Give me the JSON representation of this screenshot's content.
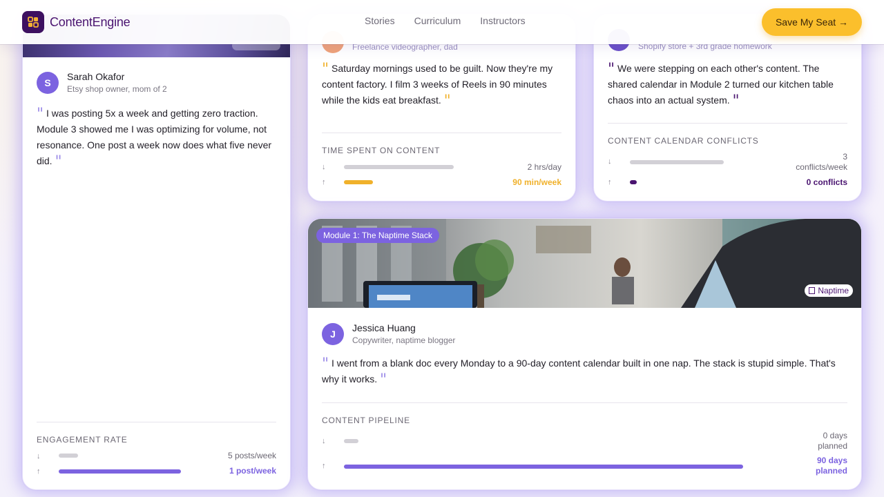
{
  "header": {
    "brand": "ContentEngine",
    "nav": [
      "Stories",
      "Curriculum",
      "Instructors"
    ],
    "cta": "Save My Seat →"
  },
  "colors": {
    "brand": "#4a1470",
    "accent": "#7c63e0",
    "cta": "#fbbf2c",
    "gold": "#f0b12b",
    "deep_purple": "#4a1470"
  },
  "cards": {
    "sarah": {
      "avatar_initial": "S",
      "name": "Sarah Okafor",
      "role": "Etsy shop owner, mom of 2",
      "quote": "I was posting 5x a week and getting zero traction. Module 3 showed me I was optimizing for volume, not resonance. One post a week now does what five never did.",
      "metric_title": "ENGAGEMENT RATE",
      "before_value": "5 posts/week",
      "after_value": "1 post/week",
      "before_fill_pct": 12,
      "after_fill_pct": 60
    },
    "video": {
      "role": "Freelance videographer, dad",
      "quote": "Saturday mornings used to be guilt. Now they're my content factory. I film 3 weeks of Reels in 90 minutes while the kids eat breakfast.",
      "metric_title": "TIME SPENT ON CONTENT",
      "before_value": "2 hrs/day",
      "after_value": "90 min/week",
      "before_fill_pct": 53,
      "after_fill_pct": 14
    },
    "shopify": {
      "role": "Shopify store + 3rd grade homework",
      "quote": "We were stepping on each other's content. The shared calendar in Module 2 turned our kitchen table chaos into an actual system.",
      "metric_title": "CONTENT CALENDAR CONFLICTS",
      "before_value_1": "3",
      "before_value_2": "conflicts/week",
      "after_value": "0 conflicts",
      "before_fill_pct": 53,
      "after_fill_pct": 4
    },
    "jessica": {
      "module_badge": "Module 1: The Naptime Stack",
      "tag_icon": "moon-icon",
      "tag": "Naptime",
      "avatar_initial": "J",
      "name": "Jessica Huang",
      "role": "Copywriter, naptime blogger",
      "quote": "I went from a blank doc every Monday to a 90-day content calendar built in one nap. The stack is stupid simple. That's why it works.",
      "metric_title": "CONTENT PIPELINE",
      "before_value_1": "0 days",
      "before_value_2": "planned",
      "after_value_1": "90 days",
      "after_value_2": "planned",
      "before_fill_pct": 3,
      "after_fill_pct": 75
    }
  },
  "arrows": {
    "down": "↓",
    "up": "↑",
    "quote": "\""
  }
}
